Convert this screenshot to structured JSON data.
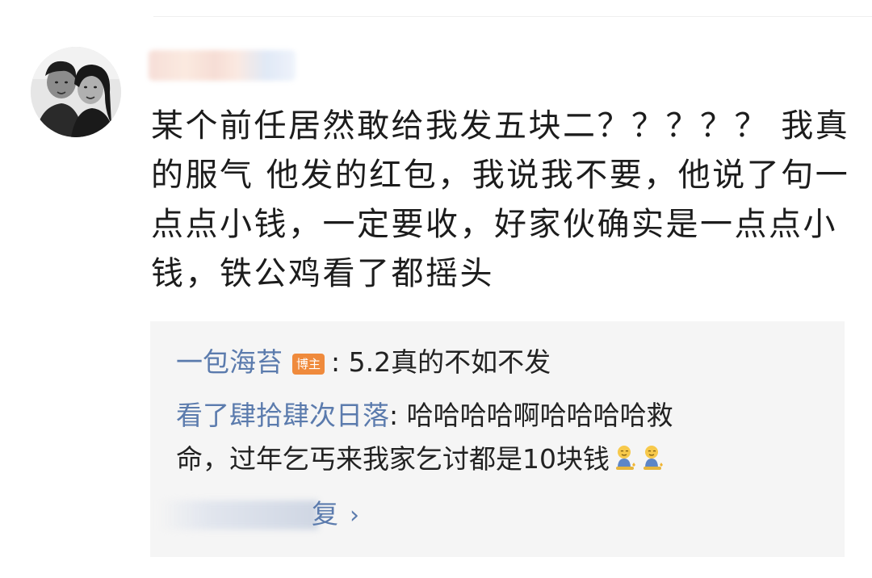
{
  "comment": {
    "username": "",
    "text": "某个前任居然敢给我发五块二？？？？？ 我真的服气 他发的红包，我说我不要，他说了句一点点小钱，一定要收，好家伙确实是一点点小钱，铁公鸡看了都摇头"
  },
  "replies": [
    {
      "user": "一包海苔",
      "badge": "博主",
      "text": ": 5.2真的不如不发"
    },
    {
      "user": "看了肆拾肆次日落",
      "text_line1": ": 哈哈哈哈啊哈哈哈哈救",
      "text_line2": "命，过年乞丐来我家乞讨都是10块钱",
      "emojis": [
        "kneeling-emoji",
        "kneeling-emoji"
      ]
    }
  ],
  "more": {
    "label": "复",
    "chevron": "›"
  },
  "icons": {
    "avatar": "avatar-photo",
    "chevron": "chevron-right-icon",
    "emoji": "kneeling-emoji"
  },
  "colors": {
    "link_blue": "#5b7bad",
    "badge_orange": "#ef8a3c",
    "reply_bg": "#f5f5f5",
    "text": "#1c1c1c"
  }
}
